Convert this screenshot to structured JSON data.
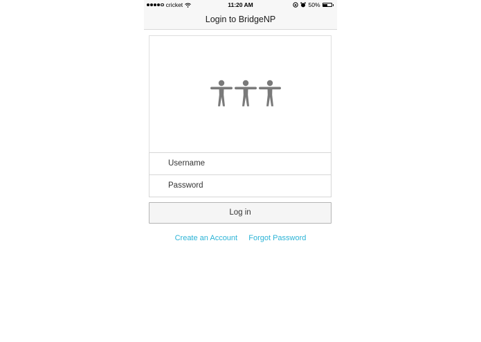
{
  "status_bar": {
    "carrier": "cricket",
    "time": "11:20 AM",
    "battery_percent": "50%",
    "signal_bars": 4,
    "icons": [
      "wifi-icon",
      "rotation-lock-icon",
      "alarm-icon",
      "battery-icon"
    ]
  },
  "nav": {
    "title": "Login to BridgeNP"
  },
  "logo": {
    "icon": "people-logo-icon",
    "figure_count": 3,
    "color": "#7a7a7a"
  },
  "form": {
    "username_placeholder": "Username",
    "password_placeholder": "Password",
    "login_label": "Log in"
  },
  "links": {
    "create_account": "Create an Account",
    "forgot_password": "Forgot Password",
    "color": "#2bb3d6"
  }
}
